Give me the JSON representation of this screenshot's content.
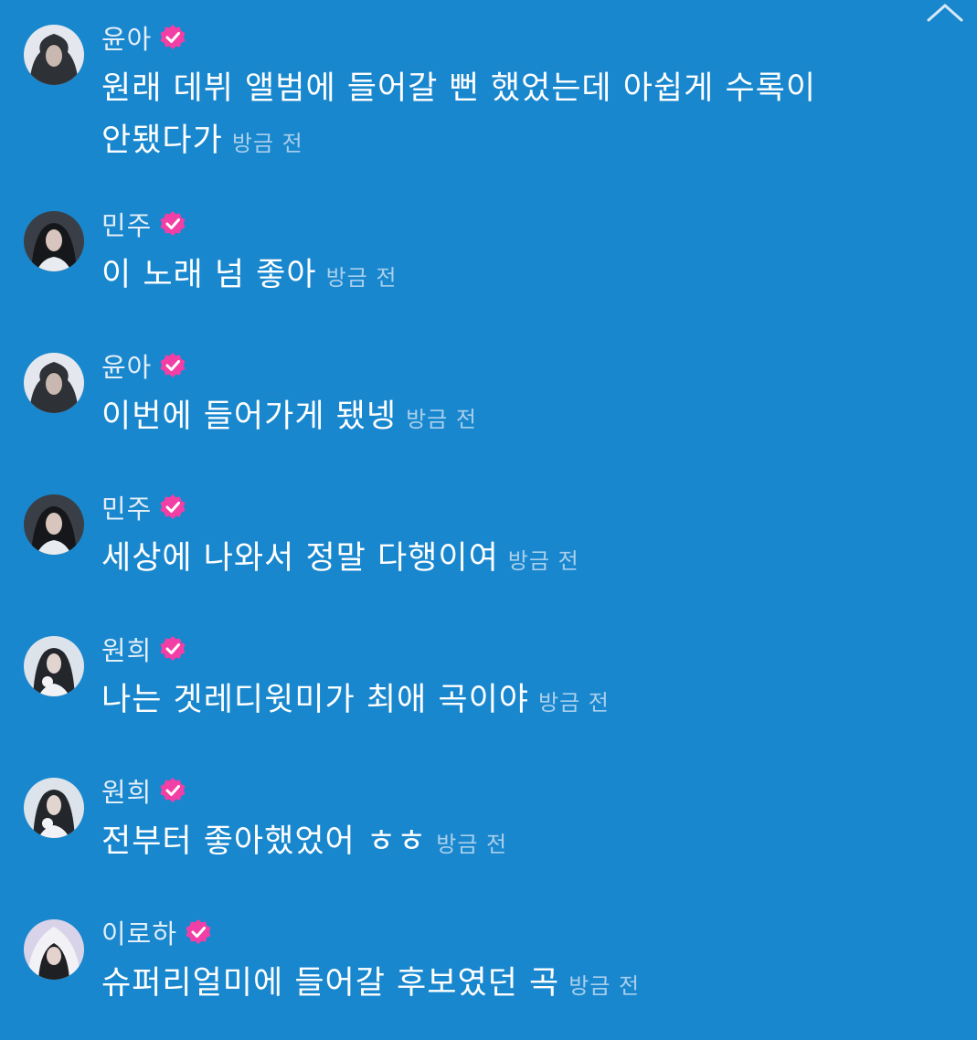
{
  "colors": {
    "background": "#1887CE",
    "verified_badge": "#F23FA5",
    "username": "#E3EEF8",
    "message": "#FFFFFF",
    "timestamp": "#A9CFEC"
  },
  "header": {
    "collapse_icon": "chevron-up-icon"
  },
  "messages": [
    {
      "username": "윤아",
      "verified": true,
      "text": "원래 데뷔 앨범에 들어갈 뻔 했었는데 아쉽게 수록이 안됐다가",
      "time": "방금 전"
    },
    {
      "username": "민주",
      "verified": true,
      "text": "이 노래 넘 좋아",
      "time": "방금 전"
    },
    {
      "username": "윤아",
      "verified": true,
      "text": "이번에 들어가게 됐넹",
      "time": "방금 전"
    },
    {
      "username": "민주",
      "verified": true,
      "text": "세상에 나와서 정말 다행이여",
      "time": "방금 전"
    },
    {
      "username": "원희",
      "verified": true,
      "text": "나는 겟레디윗미가 최애 곡이야",
      "time": "방금 전"
    },
    {
      "username": "원희",
      "verified": true,
      "text": "전부터 좋아했었어 ㅎㅎ",
      "time": "방금 전"
    },
    {
      "username": "이로하",
      "verified": true,
      "text": "슈퍼리얼미에 들어갈 후보였던 곡",
      "time": "방금 전"
    }
  ]
}
